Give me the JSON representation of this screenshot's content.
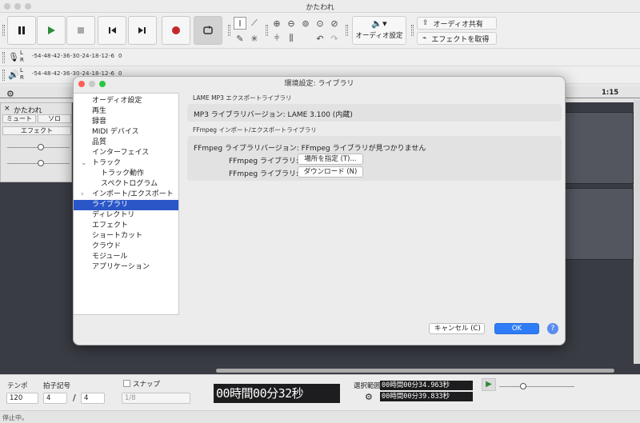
{
  "window": {
    "title": "かたわれ"
  },
  "toolbar": {
    "audio_setup": "オーディオ設定",
    "share_audio": "オーディオ共有",
    "get_effects": "エフェクトを取得"
  },
  "meters": {
    "scale": [
      "-54",
      "-48",
      "-42",
      "-36",
      "-30",
      "-24",
      "-18",
      "-12",
      "-6",
      "0"
    ],
    "channel_l": "L",
    "channel_r": "R"
  },
  "ruler": {
    "mark": "1:15"
  },
  "track": {
    "name": "かたわれ",
    "mute": "ミュート",
    "solo": "ソロ",
    "effects": "エフェクト"
  },
  "dialog": {
    "title": "環境設定: ライブラリ",
    "nav": [
      {
        "label": "オーディオ設定",
        "indent": 0,
        "arrow": ""
      },
      {
        "label": "再生",
        "indent": 0,
        "arrow": ""
      },
      {
        "label": "録音",
        "indent": 0,
        "arrow": ""
      },
      {
        "label": "MIDI デバイス",
        "indent": 0,
        "arrow": ""
      },
      {
        "label": "品質",
        "indent": 0,
        "arrow": ""
      },
      {
        "label": "インターフェイス",
        "indent": 0,
        "arrow": ""
      },
      {
        "label": "トラック",
        "indent": 0,
        "arrow": "v"
      },
      {
        "label": "トラック動作",
        "indent": 1,
        "arrow": ""
      },
      {
        "label": "スペクトログラム",
        "indent": 1,
        "arrow": ""
      },
      {
        "label": "インポート/エクスポート",
        "indent": 0,
        "arrow": ">"
      },
      {
        "label": "ライブラリ",
        "indent": 0,
        "arrow": "",
        "selected": true
      },
      {
        "label": "ディレクトリ",
        "indent": 0,
        "arrow": ""
      },
      {
        "label": "エフェクト",
        "indent": 0,
        "arrow": ""
      },
      {
        "label": "ショートカット",
        "indent": 0,
        "arrow": ""
      },
      {
        "label": "クラウド",
        "indent": 0,
        "arrow": ""
      },
      {
        "label": "モジュール",
        "indent": 0,
        "arrow": ""
      },
      {
        "label": "アプリケーション",
        "indent": 0,
        "arrow": ""
      }
    ],
    "lame_section": "LAME MP3 エクスポートライブラリ",
    "lame_version": "MP3 ライブラリバージョン: LAME 3.100 (内蔵)",
    "ffmpeg_section": "FFmpeg インポート/エクスポートライブラリ",
    "ffmpeg_version": "FFmpeg ライブラリバージョン: FFmpeg ライブラリが見つかりません",
    "ffmpeg_lib_label_1": "FFmpeg ライブラリ:",
    "locate_button": "場所を指定 (T)...",
    "ffmpeg_lib_label_2": "FFmpeg ライブラリ:",
    "download_button": "ダウンロード (N)",
    "cancel_button": "キャンセル (C)",
    "ok_button": "OK",
    "help_button": "?"
  },
  "bottom": {
    "tempo_label": "テンポ",
    "tempo_value": "120",
    "timesig_label": "拍子記号",
    "timesig_num": "4",
    "timesig_sep": "/",
    "timesig_den": "4",
    "snap_label": "スナップ",
    "snap_value": "1/8",
    "time_display": "00時間00分32秒",
    "selection_label": "選択範囲",
    "sel_start": "00時間00分34.963秒",
    "sel_end": "00時間00分39.833秒"
  },
  "status": {
    "text": "停止中。"
  }
}
